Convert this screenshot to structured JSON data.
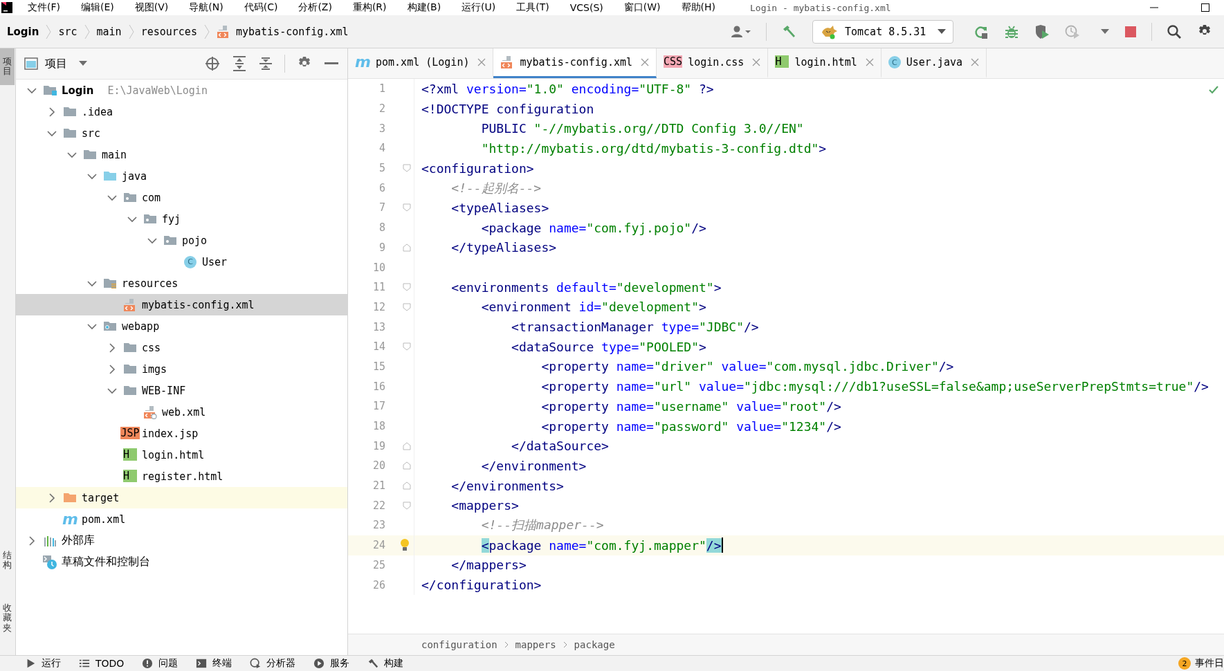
{
  "window": {
    "title": "Login - mybatis-config.xml"
  },
  "menu": [
    {
      "label": "文件(F)"
    },
    {
      "label": "编辑(E)"
    },
    {
      "label": "视图(V)"
    },
    {
      "label": "导航(N)"
    },
    {
      "label": "代码(C)"
    },
    {
      "label": "分析(Z)"
    },
    {
      "label": "重构(R)"
    },
    {
      "label": "构建(B)"
    },
    {
      "label": "运行(U)"
    },
    {
      "label": "工具(T)"
    },
    {
      "label": "VCS(S)"
    },
    {
      "label": "窗口(W)"
    },
    {
      "label": "帮助(H)"
    }
  ],
  "breadcrumb": [
    {
      "label": "Login",
      "kind": "module"
    },
    {
      "label": "src",
      "kind": "dir"
    },
    {
      "label": "main",
      "kind": "dir"
    },
    {
      "label": "resources",
      "kind": "dir"
    },
    {
      "label": "mybatis-config.xml",
      "kind": "xml"
    }
  ],
  "run_config": {
    "label": "Tomcat 8.5.31"
  },
  "side_stripe": [
    {
      "label": "项目",
      "selected": true
    },
    {
      "label": "结构",
      "selected": false
    },
    {
      "label": "收藏夹",
      "selected": false
    }
  ],
  "project": {
    "title": "项目",
    "tree": [
      {
        "label": "Login",
        "hint": "E:\\JavaWeb\\Login",
        "kind": "module",
        "expanded": true,
        "selected": false,
        "children": [
          {
            "label": ".idea",
            "kind": "folder",
            "expanded": false,
            "selected": false
          },
          {
            "label": "src",
            "kind": "folder",
            "expanded": true,
            "selected": false,
            "children": [
              {
                "label": "main",
                "kind": "folder",
                "expanded": true,
                "selected": false,
                "children": [
                  {
                    "label": "java",
                    "kind": "src-folder",
                    "expanded": true,
                    "selected": false,
                    "children": [
                      {
                        "label": "com",
                        "kind": "package",
                        "expanded": true,
                        "selected": false,
                        "children": [
                          {
                            "label": "fyj",
                            "kind": "package",
                            "expanded": true,
                            "selected": false,
                            "children": [
                              {
                                "label": "pojo",
                                "kind": "package",
                                "expanded": true,
                                "selected": false,
                                "children": [
                                  {
                                    "label": "User",
                                    "kind": "class",
                                    "icon_text": "C",
                                    "selected": false
                                  }
                                ]
                              }
                            ]
                          }
                        ]
                      }
                    ]
                  },
                  {
                    "label": "resources",
                    "kind": "res-folder",
                    "expanded": true,
                    "selected": false,
                    "children": [
                      {
                        "label": "mybatis-config.xml",
                        "kind": "xml",
                        "selected": true
                      }
                    ]
                  },
                  {
                    "label": "webapp",
                    "kind": "web-folder",
                    "expanded": true,
                    "selected": false,
                    "children": [
                      {
                        "label": "css",
                        "kind": "folder",
                        "expanded": false,
                        "selected": false
                      },
                      {
                        "label": "imgs",
                        "kind": "folder",
                        "expanded": false,
                        "selected": false
                      },
                      {
                        "label": "WEB-INF",
                        "kind": "folder",
                        "expanded": true,
                        "selected": false,
                        "children": [
                          {
                            "label": "web.xml",
                            "kind": "web-xml",
                            "selected": false
                          }
                        ]
                      },
                      {
                        "label": "index.jsp",
                        "kind": "jsp",
                        "icon_text": "JSP",
                        "selected": false
                      },
                      {
                        "label": "login.html",
                        "kind": "html",
                        "icon_text": "H",
                        "selected": false
                      },
                      {
                        "label": "register.html",
                        "kind": "html",
                        "icon_text": "H",
                        "selected": false
                      }
                    ]
                  }
                ]
              }
            ]
          },
          {
            "label": "target",
            "kind": "excluded-folder",
            "expanded": false,
            "selected": false,
            "highlighted": true
          },
          {
            "label": "pom.xml",
            "kind": "maven",
            "icon_text": "m",
            "selected": false
          }
        ]
      },
      {
        "label": "外部库",
        "kind": "library",
        "expanded": false,
        "selected": false
      },
      {
        "label": "草稿文件和控制台",
        "kind": "scratch",
        "selected": false
      }
    ]
  },
  "tabs": [
    {
      "label": "pom.xml (Login)",
      "kind": "maven",
      "icon_text": "m",
      "selected": false
    },
    {
      "label": "mybatis-config.xml",
      "kind": "xml",
      "selected": true
    },
    {
      "label": "login.css",
      "kind": "css",
      "icon_text": "CSS",
      "selected": false
    },
    {
      "label": "login.html",
      "kind": "html",
      "icon_text": "H",
      "selected": false
    },
    {
      "label": "User.java",
      "kind": "class",
      "icon_text": "C",
      "selected": false
    }
  ],
  "editor": {
    "lines": [
      {
        "number": "1",
        "current": false,
        "tokens": [
          {
            "kind": "tag",
            "text": "<?xml "
          },
          {
            "kind": "attr",
            "text": "version="
          },
          {
            "kind": "value",
            "text": "\"1.0\""
          },
          {
            "kind": "attr",
            "text": " encoding="
          },
          {
            "kind": "value",
            "text": "\"UTF-8\""
          },
          {
            "kind": "tag",
            "text": " ?>"
          }
        ]
      },
      {
        "number": "2",
        "current": false,
        "tokens": [
          {
            "kind": "tag",
            "text": "<!DOCTYPE configuration"
          }
        ]
      },
      {
        "number": "3",
        "current": false,
        "tokens": [
          {
            "kind": "tag",
            "text": "        PUBLIC "
          },
          {
            "kind": "value",
            "text": "\"-//mybatis.org//DTD Config 3.0//EN\""
          }
        ]
      },
      {
        "number": "4",
        "current": false,
        "tokens": [
          {
            "kind": "value",
            "text": "        \"http://mybatis.org/dtd/mybatis-3-config.dtd\""
          },
          {
            "kind": "tag",
            "text": ">"
          }
        ]
      },
      {
        "number": "5",
        "current": false,
        "kind": "opener",
        "tokens": [
          {
            "kind": "tag",
            "text": "<configuration>"
          }
        ]
      },
      {
        "number": "6",
        "current": false,
        "tokens": [
          {
            "kind": "comment",
            "text": "    <!--起别名-->"
          }
        ]
      },
      {
        "number": "7",
        "current": false,
        "kind": "opener",
        "tokens": [
          {
            "kind": "tag",
            "text": "    <typeAliases>"
          }
        ]
      },
      {
        "number": "8",
        "current": false,
        "tokens": [
          {
            "kind": "tag",
            "text": "        <package "
          },
          {
            "kind": "attr",
            "text": "name="
          },
          {
            "kind": "value",
            "text": "\"com.fyj.pojo\""
          },
          {
            "kind": "tag",
            "text": "/>"
          }
        ]
      },
      {
        "number": "9",
        "current": false,
        "kind": "closer",
        "tokens": [
          {
            "kind": "tag",
            "text": "    </typeAliases>"
          }
        ]
      },
      {
        "number": "10",
        "current": false
      },
      {
        "number": "11",
        "current": false,
        "kind": "opener",
        "tokens": [
          {
            "kind": "tag",
            "text": "    <environments "
          },
          {
            "kind": "attr",
            "text": "default="
          },
          {
            "kind": "value",
            "text": "\"development\""
          },
          {
            "kind": "tag",
            "text": ">"
          }
        ]
      },
      {
        "number": "12",
        "current": false,
        "kind": "opener",
        "tokens": [
          {
            "kind": "tag",
            "text": "        <environment "
          },
          {
            "kind": "attr",
            "text": "id="
          },
          {
            "kind": "value",
            "text": "\"development\""
          },
          {
            "kind": "tag",
            "text": ">"
          }
        ]
      },
      {
        "number": "13",
        "current": false,
        "tokens": [
          {
            "kind": "tag",
            "text": "            <transactionManager "
          },
          {
            "kind": "attr",
            "text": "type="
          },
          {
            "kind": "value",
            "text": "\"JDBC\""
          },
          {
            "kind": "tag",
            "text": "/>"
          }
        ]
      },
      {
        "number": "14",
        "current": false,
        "kind": "opener",
        "tokens": [
          {
            "kind": "tag",
            "text": "            <dataSource "
          },
          {
            "kind": "attr",
            "text": "type="
          },
          {
            "kind": "value",
            "text": "\"POOLED\""
          },
          {
            "kind": "tag",
            "text": ">"
          }
        ]
      },
      {
        "number": "15",
        "current": false,
        "tokens": [
          {
            "kind": "tag",
            "text": "                <property "
          },
          {
            "kind": "attr",
            "text": "name="
          },
          {
            "kind": "value",
            "text": "\"driver\""
          },
          {
            "kind": "attr",
            "text": " value="
          },
          {
            "kind": "value",
            "text": "\"com.mysql.jdbc.Driver\""
          },
          {
            "kind": "tag",
            "text": "/>"
          }
        ]
      },
      {
        "number": "16",
        "current": false,
        "tokens": [
          {
            "kind": "tag",
            "text": "                <property "
          },
          {
            "kind": "attr",
            "text": "name="
          },
          {
            "kind": "value",
            "text": "\"url\""
          },
          {
            "kind": "attr",
            "text": " value="
          },
          {
            "kind": "value",
            "text": "\"jdbc:mysql:///db1?useSSL=false&amp;useServerPrepStmts=true\""
          },
          {
            "kind": "tag",
            "text": "/>"
          }
        ]
      },
      {
        "number": "17",
        "current": false,
        "tokens": [
          {
            "kind": "tag",
            "text": "                <property "
          },
          {
            "kind": "attr",
            "text": "name="
          },
          {
            "kind": "value",
            "text": "\"username\""
          },
          {
            "kind": "attr",
            "text": " value="
          },
          {
            "kind": "value",
            "text": "\"root\""
          },
          {
            "kind": "tag",
            "text": "/>"
          }
        ]
      },
      {
        "number": "18",
        "current": false,
        "tokens": [
          {
            "kind": "tag",
            "text": "                <property "
          },
          {
            "kind": "attr",
            "text": "name="
          },
          {
            "kind": "value",
            "text": "\"password\""
          },
          {
            "kind": "attr",
            "text": " value="
          },
          {
            "kind": "value",
            "text": "\"1234\""
          },
          {
            "kind": "tag",
            "text": "/>"
          }
        ]
      },
      {
        "number": "19",
        "current": false,
        "kind": "closer",
        "tokens": [
          {
            "kind": "tag",
            "text": "            </dataSource>"
          }
        ]
      },
      {
        "number": "20",
        "current": false,
        "kind": "closer",
        "tokens": [
          {
            "kind": "tag",
            "text": "        </environment>"
          }
        ]
      },
      {
        "number": "21",
        "current": false,
        "kind": "closer",
        "tokens": [
          {
            "kind": "tag",
            "text": "    </environments>"
          }
        ]
      },
      {
        "number": "22",
        "current": false,
        "kind": "opener",
        "tokens": [
          {
            "kind": "tag",
            "text": "    <mappers>"
          }
        ]
      },
      {
        "number": "23",
        "current": false,
        "tokens": [
          {
            "kind": "comment",
            "text": "        <!--扫描mapper-->"
          }
        ]
      },
      {
        "number": "24",
        "current": true,
        "kind": "hint",
        "tokens": [
          {
            "kind": "match",
            "text": "        <"
          },
          {
            "kind": "tag",
            "text": "package "
          },
          {
            "kind": "attr",
            "text": "name="
          },
          {
            "kind": "value",
            "text": "\"com.fyj.mapper\""
          },
          {
            "kind": "match",
            "text": "/>"
          }
        ]
      },
      {
        "number": "25",
        "current": false,
        "tokens": [
          {
            "kind": "tag",
            "text": "    </mappers>"
          }
        ]
      },
      {
        "number": "26",
        "current": false,
        "tokens": [
          {
            "kind": "tag",
            "text": "</configuration>"
          }
        ]
      }
    ],
    "path": [
      {
        "label": "configuration"
      },
      {
        "label": "mappers"
      },
      {
        "label": "package"
      }
    ]
  },
  "bottom_bar": [
    {
      "label": "运行",
      "kind": "run"
    },
    {
      "label": "TODO",
      "kind": "list"
    },
    {
      "label": "问题",
      "kind": "info"
    },
    {
      "label": "终端",
      "kind": "terminal"
    },
    {
      "label": "分析器",
      "kind": "profiler"
    },
    {
      "label": "服务",
      "kind": "services"
    },
    {
      "label": "构建",
      "kind": "build"
    }
  ],
  "event_log": {
    "count": "2",
    "label": "事件日"
  }
}
